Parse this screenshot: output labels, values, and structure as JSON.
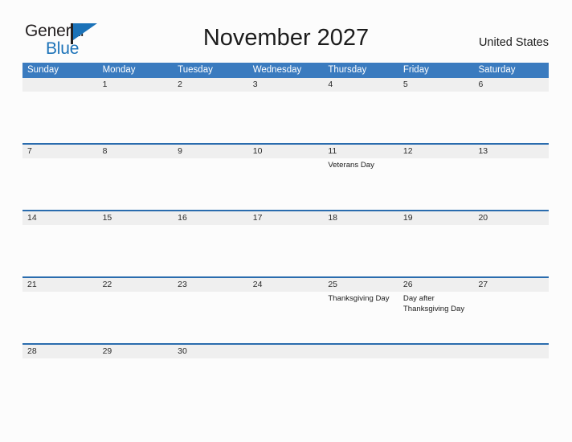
{
  "brand": {
    "name_top": "General",
    "name_bottom": "Blue",
    "flag_icon": "flag-triangle-icon",
    "accent_color": "#1b72b8"
  },
  "header": {
    "title": "November 2027",
    "region": "United States"
  },
  "calendar": {
    "header_bg": "#3a7bbf",
    "date_band_bg": "#efefef",
    "rule_color": "#2a6cae",
    "weekdays": [
      "Sunday",
      "Monday",
      "Tuesday",
      "Wednesday",
      "Thursday",
      "Friday",
      "Saturday"
    ],
    "weeks": [
      [
        {
          "date": "",
          "event": ""
        },
        {
          "date": "1",
          "event": ""
        },
        {
          "date": "2",
          "event": ""
        },
        {
          "date": "3",
          "event": ""
        },
        {
          "date": "4",
          "event": ""
        },
        {
          "date": "5",
          "event": ""
        },
        {
          "date": "6",
          "event": ""
        }
      ],
      [
        {
          "date": "7",
          "event": ""
        },
        {
          "date": "8",
          "event": ""
        },
        {
          "date": "9",
          "event": ""
        },
        {
          "date": "10",
          "event": ""
        },
        {
          "date": "11",
          "event": "Veterans Day"
        },
        {
          "date": "12",
          "event": ""
        },
        {
          "date": "13",
          "event": ""
        }
      ],
      [
        {
          "date": "14",
          "event": ""
        },
        {
          "date": "15",
          "event": ""
        },
        {
          "date": "16",
          "event": ""
        },
        {
          "date": "17",
          "event": ""
        },
        {
          "date": "18",
          "event": ""
        },
        {
          "date": "19",
          "event": ""
        },
        {
          "date": "20",
          "event": ""
        }
      ],
      [
        {
          "date": "21",
          "event": ""
        },
        {
          "date": "22",
          "event": ""
        },
        {
          "date": "23",
          "event": ""
        },
        {
          "date": "24",
          "event": ""
        },
        {
          "date": "25",
          "event": "Thanksgiving Day"
        },
        {
          "date": "26",
          "event": "Day after Thanksgiving Day"
        },
        {
          "date": "27",
          "event": ""
        }
      ],
      [
        {
          "date": "28",
          "event": ""
        },
        {
          "date": "29",
          "event": ""
        },
        {
          "date": "30",
          "event": ""
        },
        {
          "date": "",
          "event": ""
        },
        {
          "date": "",
          "event": ""
        },
        {
          "date": "",
          "event": ""
        },
        {
          "date": "",
          "event": ""
        }
      ]
    ]
  }
}
